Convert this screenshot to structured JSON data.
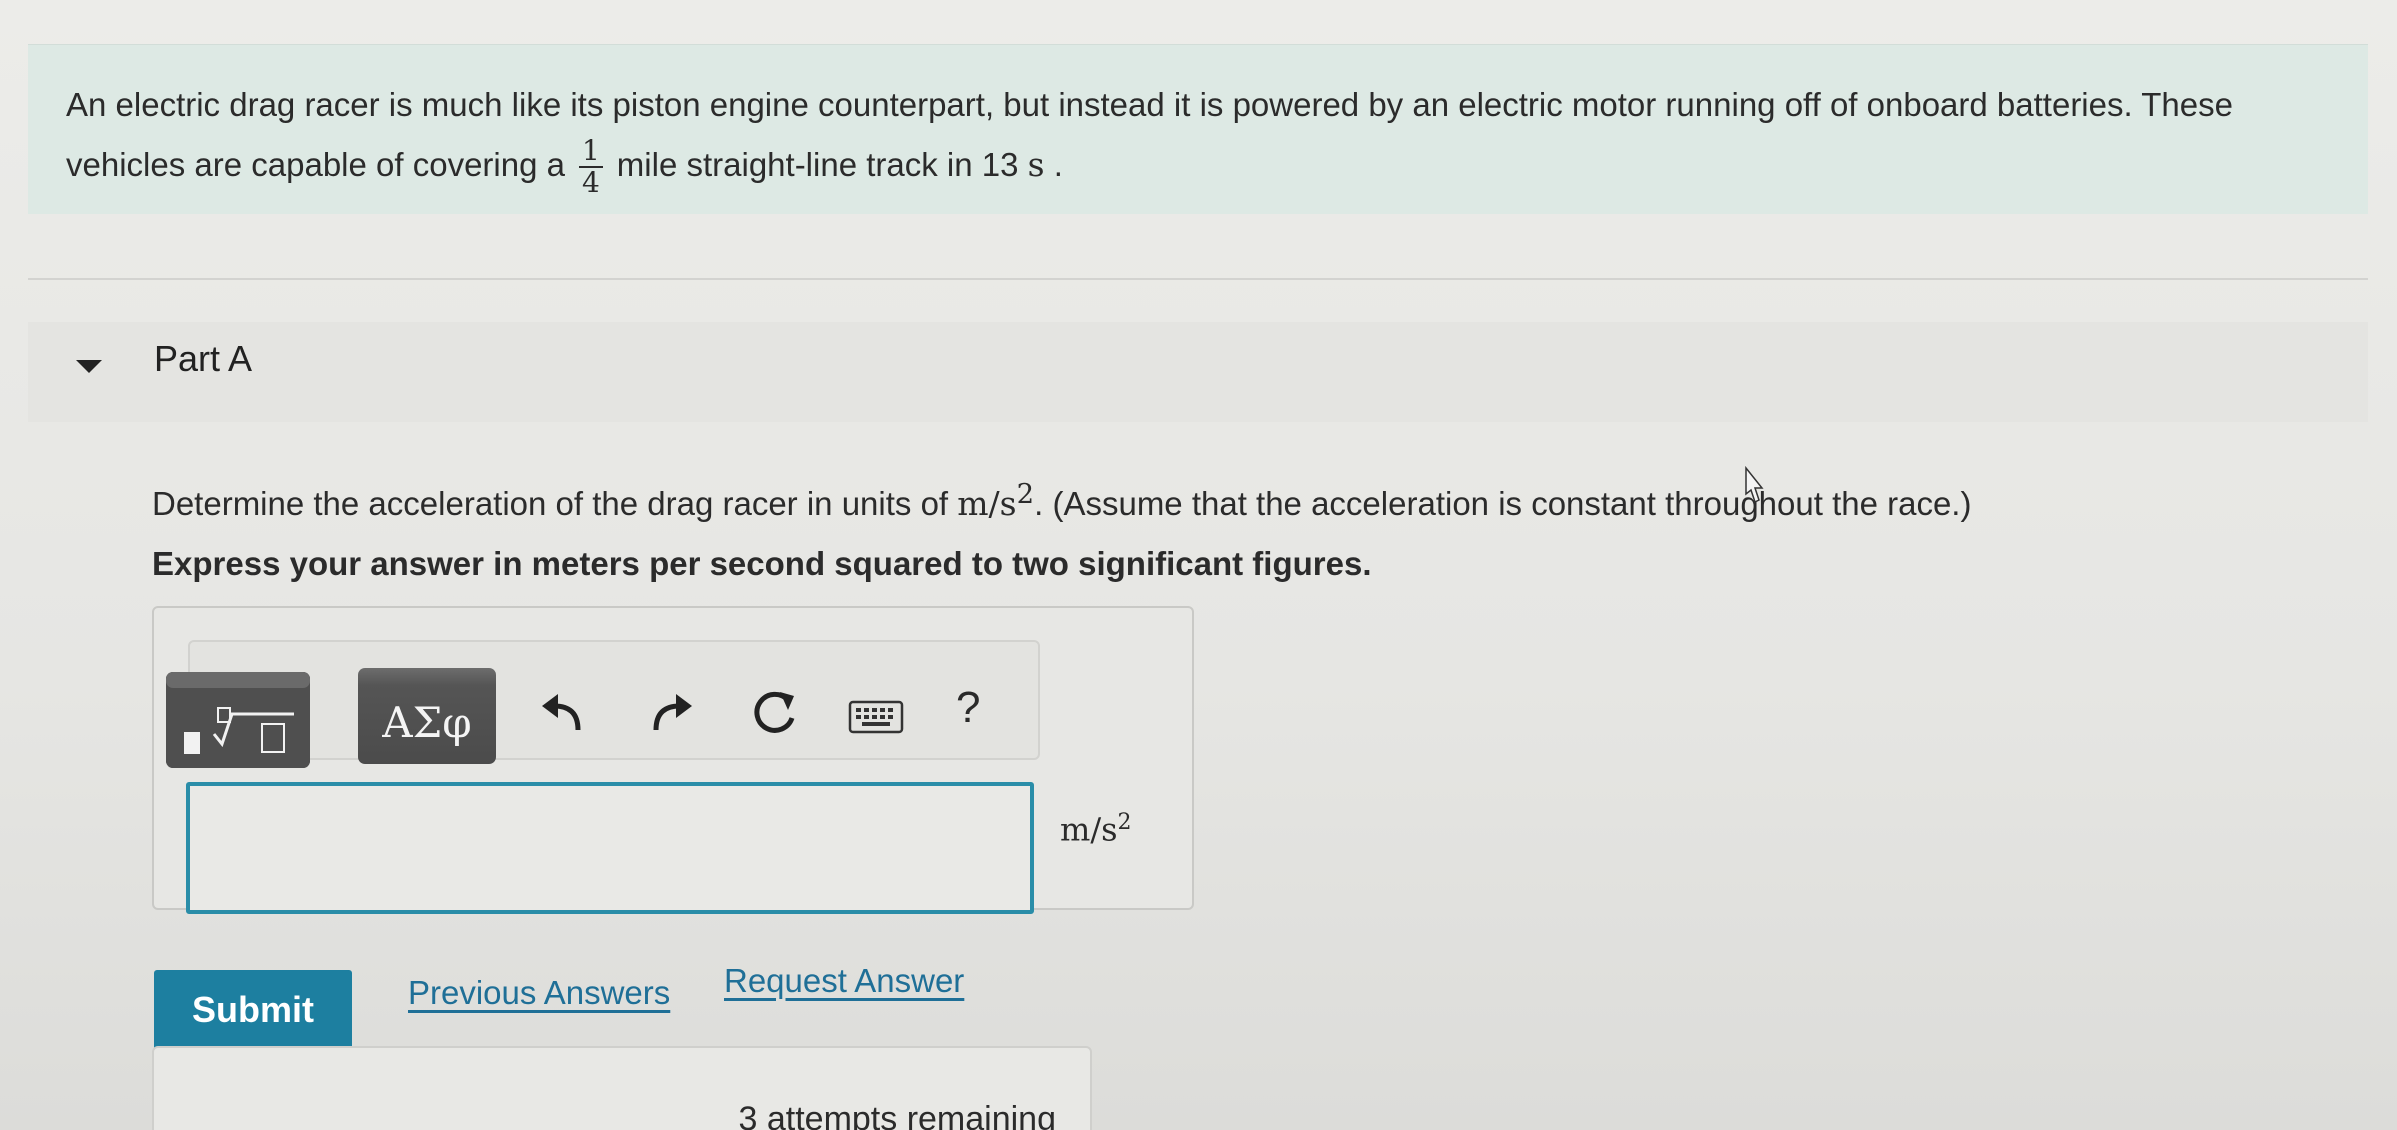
{
  "intro": {
    "line1": "An electric drag racer is much like its piston engine counterpart, but instead it is powered by an electric motor running off of onboard batteries. These",
    "line2_before": "vehicles are capable of covering a",
    "fraction_num": "1",
    "fraction_den": "4",
    "line2_after": "mile straight-line track in 13",
    "line2_unit": "s",
    "line2_end": "."
  },
  "part": {
    "title": "Part A"
  },
  "question": {
    "before": "Determine the acceleration of the drag racer in units of",
    "unit": "m/s",
    "unit_exp": "2",
    "after": ". (Assume that the acceleration is constant throughout the race.)"
  },
  "instruction": "Express your answer in meters per second squared to two significant figures.",
  "toolbar": {
    "symbols_label": "ΑΣφ",
    "help_label": "?"
  },
  "answer": {
    "value": "",
    "unit": "m/s",
    "unit_exp": "2"
  },
  "actions": {
    "submit_label": "Submit",
    "previous_answers_label": "Previous Answers",
    "request_answer_label": "Request Answer"
  },
  "attempts": {
    "text": "3 attempts remaining"
  },
  "colors": {
    "intro_bg": "#dde9e4",
    "submit_bg": "#1d7fa0",
    "link": "#1f6f97",
    "input_border": "#2a8da8"
  }
}
